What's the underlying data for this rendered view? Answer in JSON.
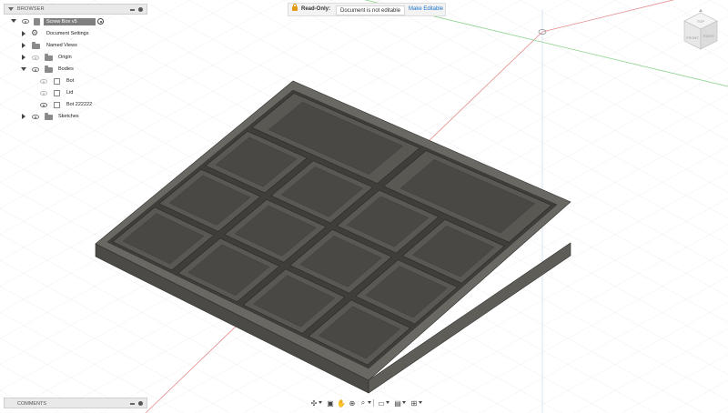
{
  "browser": {
    "title": "BROWSER",
    "document_name": "Screw Box v5",
    "items": [
      {
        "label": "Document Settings"
      },
      {
        "label": "Named Views"
      },
      {
        "label": "Origin"
      },
      {
        "label": "Bodies"
      },
      {
        "label": "Bot"
      },
      {
        "label": "Lid"
      },
      {
        "label": "Bot 222222"
      },
      {
        "label": "Sketches"
      }
    ]
  },
  "readonly_bar": {
    "label": "Read-Only:",
    "message": "Document is not editable",
    "action": "Make Editable"
  },
  "comments": {
    "title": "COMMENTS"
  },
  "viewcube": {
    "top_label": "TOP",
    "front_label": "FRONT",
    "right_label": "RIGHT"
  },
  "colors": {
    "accent": "#1b72c9",
    "lock": "#e09b16",
    "model": "#55534f",
    "axis_red": "#e58a8a",
    "axis_green": "#8cd28c"
  },
  "icons": [
    "eye-icon",
    "folder-icon",
    "gear-icon",
    "body-icon",
    "lock-icon",
    "radio-icon",
    "orbit-icon",
    "pan-icon",
    "zoom-icon",
    "display-icon",
    "grid-icon"
  ]
}
